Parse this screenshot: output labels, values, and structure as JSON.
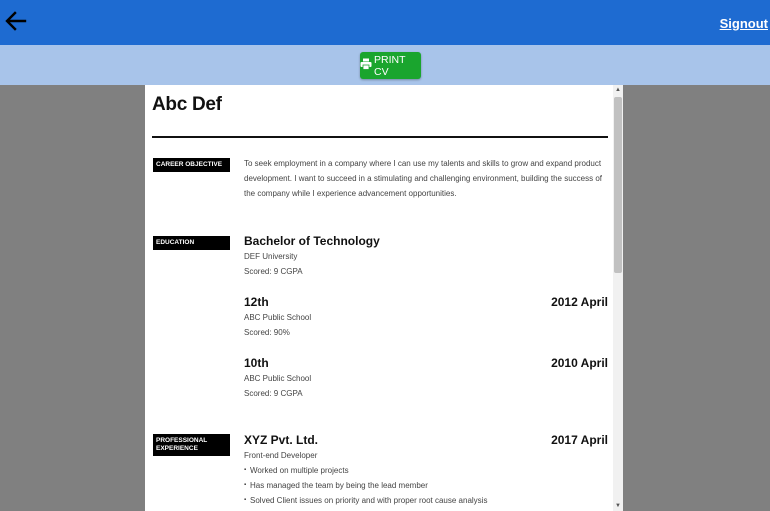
{
  "header": {
    "signout_label": "Signout"
  },
  "toolbar": {
    "print_label": "PRINT CV"
  },
  "resume": {
    "name": "Abc Def",
    "career_objective": {
      "label": "CAREER OBJECTIVE",
      "text": "To seek employment in a company where I can use my talents and skills to grow and expand product development. I want to succeed in a stimulating and challenging environment, building the success of the company while I experience advancement opportunities."
    },
    "education": {
      "label": "EDUCATION",
      "entries": [
        {
          "title": "Bachelor of Technology",
          "institution": "DEF University",
          "score": "Scored: 9 CGPA",
          "date": ""
        },
        {
          "title": "12th",
          "institution": "ABC Public School",
          "score": "Scored: 90%",
          "date": "2012 April"
        },
        {
          "title": "10th",
          "institution": "ABC Public School",
          "score": "Scored: 9 CGPA",
          "date": "2010 April"
        }
      ]
    },
    "experience": {
      "label": "PROFESSIONAL EXPERIENCE",
      "entries": [
        {
          "company": "XYZ Pvt. Ltd.",
          "role": "Front-end Developer",
          "date": "2017 April",
          "points": [
            "Worked on multiple projects",
            "Has managed the team by being the lead member",
            "Solved Client issues on priority and with proper root cause analysis"
          ]
        }
      ]
    }
  },
  "colors": {
    "topbar": "#1e6bd1",
    "subbar": "#a8c4ea",
    "print_button": "#1aa52e",
    "backdrop": "#808080"
  }
}
